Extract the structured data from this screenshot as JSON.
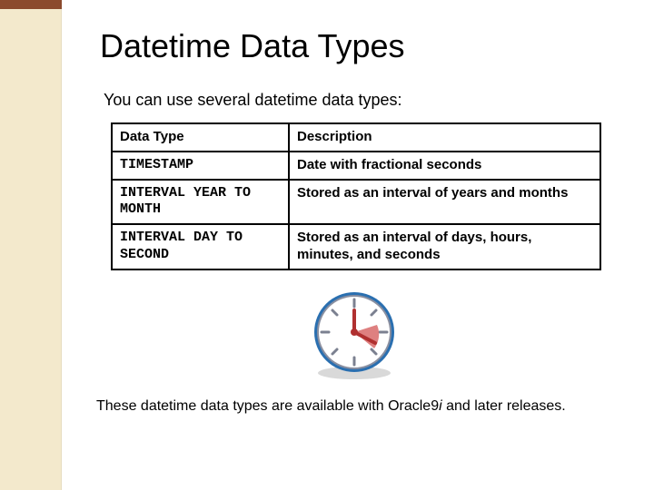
{
  "title": "Datetime Data Types",
  "intro": "You can use several datetime data types:",
  "table": {
    "headers": {
      "col1": "Data Type",
      "col2": "Description"
    },
    "rows": [
      {
        "type": "TIMESTAMP",
        "desc": "Date with fractional seconds"
      },
      {
        "type": "INTERVAL YEAR TO MONTH",
        "desc": "Stored as an interval of years and months"
      },
      {
        "type": "INTERVAL DAY TO SECOND",
        "desc": "Stored as an interval of days, hours, minutes, and seconds"
      }
    ]
  },
  "footnote": {
    "pre": "These datetime data types are available with Oracle9",
    "ital": "i",
    "post": " and later releases."
  }
}
